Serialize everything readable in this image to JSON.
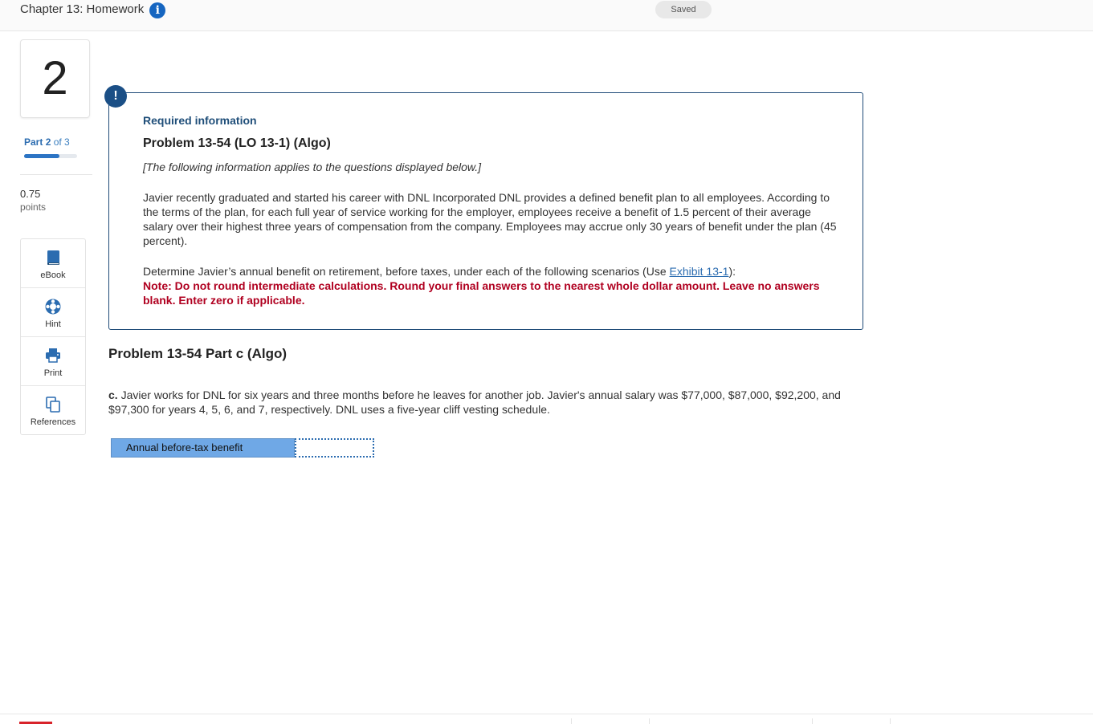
{
  "header": {
    "title": "Chapter 13: Homework",
    "info_icon": "i",
    "saved_label": "Saved"
  },
  "sidebar": {
    "question_number": "2",
    "part_prefix": "Part",
    "part_current": "2",
    "part_suffix": "of 3",
    "part_progress_fraction": 0.667,
    "points_value": "0.75",
    "points_label": "points",
    "tools": [
      {
        "label": "eBook",
        "icon": "book-icon"
      },
      {
        "label": "Hint",
        "icon": "lifebuoy-icon"
      },
      {
        "label": "Print",
        "icon": "printer-icon"
      },
      {
        "label": "References",
        "icon": "copy-icon"
      }
    ]
  },
  "required_info": {
    "badge": "!",
    "title": "Required information",
    "problem": "Problem 13-54 (LO 13-1) (Algo)",
    "note": "[The following information applies to the questions displayed below.]",
    "paragraph": "Javier recently graduated and started his career with DNL Incorporated DNL provides a defined benefit plan to all employees. According to the terms of the plan, for each full year of service working for the employer, employees receive a benefit of 1.5 percent of their average salary over their highest three years of compensation from the company. Employees may accrue only 30 years of benefit under the plan (45 percent).",
    "determine_text": "Determine Javier’s annual benefit on retirement, before taxes, under each of the following scenarios (Use ",
    "exhibit_link": "Exhibit 13-1",
    "determine_close": "):",
    "warning": "Note: Do not round intermediate calculations. Round your final answers to the nearest whole dollar amount. Leave no answers blank. Enter zero if applicable."
  },
  "part": {
    "title": "Problem 13-54 Part c (Algo)",
    "label": "c.",
    "text": "Javier works for DNL for six years and three months before he leaves for another job. Javier's annual salary was $77,000, $87,000, $92,200, and $97,300 for years 4, 5, 6, and 7, respectively. DNL uses a five-year cliff vesting schedule.",
    "answer_label": "Annual before-tax benefit",
    "answer_value": ""
  }
}
